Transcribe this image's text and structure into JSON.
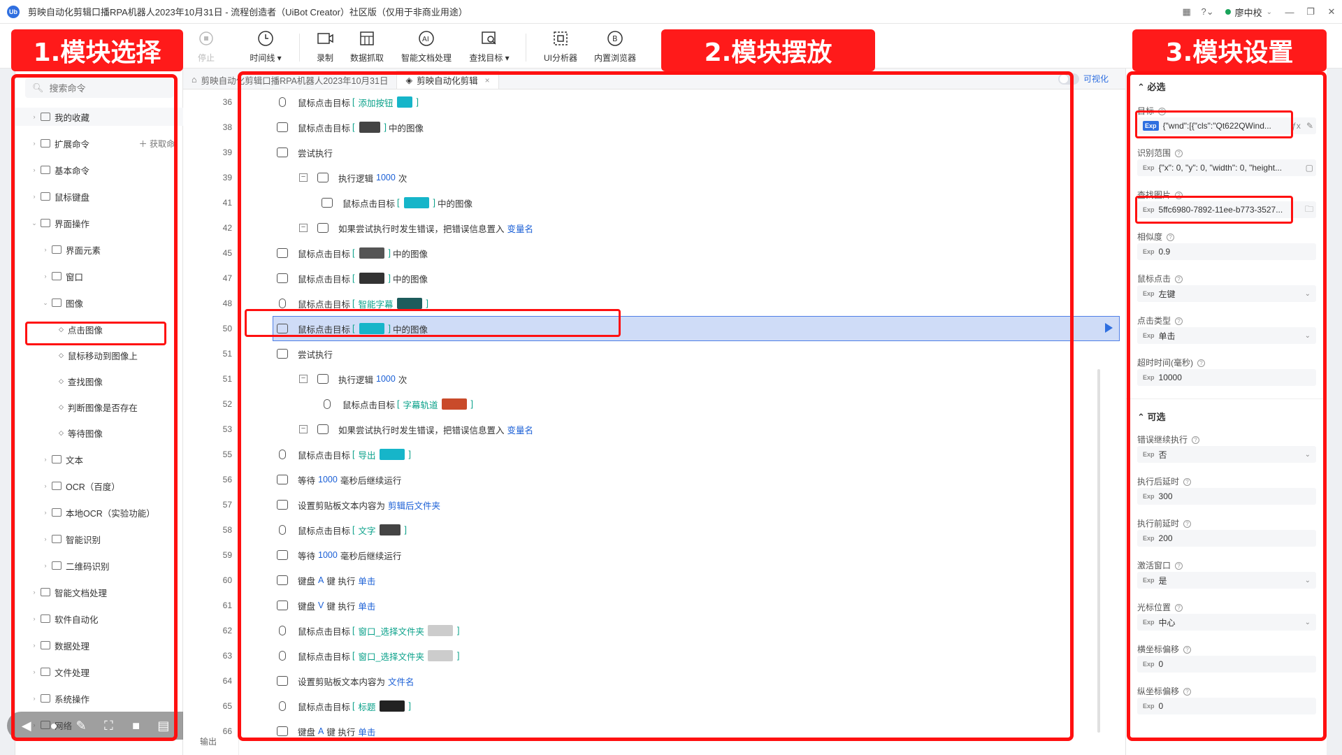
{
  "window": {
    "title": "剪映自动化剪辑口播RPA机器人2023年10月31日 - 流程创造者（UiBot Creator）社区版（仅用于非商业用途）",
    "logo": "Ub",
    "user": "廖中校"
  },
  "toolbar": {
    "stop": "停止",
    "timeline": "时间线",
    "record": "录制",
    "data_scrape": "数据抓取",
    "smart_doc": "智能文档处理",
    "find_target": "查找目标",
    "ui_analyzer": "UI分析器",
    "browser": "内置浏览器"
  },
  "sidebar": {
    "search_placeholder": "搜索命令",
    "get_cmd": "获取命",
    "items": [
      "我的收藏",
      "扩展命令",
      "基本命令",
      "鼠标键盘",
      "界面操作",
      "界面元素",
      "窗口",
      "图像",
      "点击图像",
      "鼠标移动到图像上",
      "查找图像",
      "判断图像是否存在",
      "等待图像",
      "文本",
      "OCR（百度）",
      "本地OCR（实验功能）",
      "智能识别",
      "二维码识别",
      "智能文档处理",
      "软件自动化",
      "数据处理",
      "文件处理",
      "系统操作",
      "网络"
    ]
  },
  "workspace": {
    "tab_path": "剪映自动化剪辑口播RPA机器人2023年10月31日",
    "tab_active": "剪映自动化剪辑",
    "visualize": "可视化",
    "output": "输出",
    "rows": [
      {
        "ln": "36",
        "pre": "鼠标点击目标",
        "g": "添加按钮",
        "post": ""
      },
      {
        "ln": "38",
        "pre": "鼠标点击目标",
        "g": "",
        "post": "中的图像"
      },
      {
        "ln": "39",
        "pre": "尝试执行",
        "g": "",
        "post": ""
      },
      {
        "ln": "39",
        "pre": "执行逻辑",
        "k": "1000",
        "post": "次"
      },
      {
        "ln": "41",
        "pre": "鼠标点击目标",
        "g": "",
        "post": "中的图像"
      },
      {
        "ln": "42",
        "pre": "如果尝试执行时发生错误，把错误信息置入",
        "k": "变量名",
        "post": ""
      },
      {
        "ln": "45",
        "pre": "鼠标点击目标",
        "g": "",
        "post": "中的图像"
      },
      {
        "ln": "47",
        "pre": "鼠标点击目标",
        "g": "",
        "post": "中的图像"
      },
      {
        "ln": "48",
        "pre": "鼠标点击目标",
        "g": "智能字幕",
        "post": ""
      },
      {
        "ln": "50",
        "pre": "鼠标点击目标",
        "g": "",
        "post": "中的图像"
      },
      {
        "ln": "51",
        "pre": "尝试执行",
        "g": "",
        "post": ""
      },
      {
        "ln": "51",
        "pre": "执行逻辑",
        "k": "1000",
        "post": "次"
      },
      {
        "ln": "52",
        "pre": "鼠标点击目标",
        "g": "字幕轨道",
        "post": ""
      },
      {
        "ln": "53",
        "pre": "如果尝试执行时发生错误，把错误信息置入",
        "k": "变量名",
        "post": ""
      },
      {
        "ln": "55",
        "pre": "鼠标点击目标",
        "g": "导出",
        "post": ""
      },
      {
        "ln": "56",
        "pre": "等待",
        "k": "1000",
        "post": "毫秒后继续运行"
      },
      {
        "ln": "57",
        "pre": "设置剪贴板文本内容为",
        "k": "剪辑后文件夹",
        "post": ""
      },
      {
        "ln": "58",
        "pre": "鼠标点击目标",
        "g": "文字",
        "post": ""
      },
      {
        "ln": "59",
        "pre": "等待",
        "k": "1000",
        "post": "毫秒后继续运行"
      },
      {
        "ln": "60",
        "pre": "键盘",
        "k": "A",
        "post": "键 执行",
        "k2": "单击"
      },
      {
        "ln": "61",
        "pre": "键盘",
        "k": "V",
        "post": "键 执行",
        "k2": "单击"
      },
      {
        "ln": "62",
        "pre": "鼠标点击目标",
        "g": "窗口_选择文件夹",
        "post": ""
      },
      {
        "ln": "63",
        "pre": "鼠标点击目标",
        "g": "窗口_选择文件夹",
        "post": ""
      },
      {
        "ln": "64",
        "pre": "设置剪贴板文本内容为",
        "k": "文件名",
        "post": ""
      },
      {
        "ln": "65",
        "pre": "鼠标点击目标",
        "g": "标题",
        "post": ""
      },
      {
        "ln": "66",
        "pre": "键盘",
        "k": "A",
        "post": "键 执行",
        "k2": "单击"
      }
    ]
  },
  "props": {
    "required": "必选",
    "optional": "可选",
    "target_label": "目标",
    "target_val": "{\"wnd\":[{\"cls\":\"Qt622QWind...",
    "range_label": "识别范围",
    "range_val": "{\"x\": 0, \"y\": 0, \"width\": 0, \"height...",
    "img_label": "查找图片",
    "img_val": "5ffc6980-7892-11ee-b773-3527...",
    "sim_label": "相似度",
    "sim_val": "0.9",
    "click_label": "鼠标点击",
    "click_val": "左键",
    "type_label": "点击类型",
    "type_val": "单击",
    "timeout_label": "超时时间(毫秒)",
    "timeout_val": "10000",
    "err_label": "错误继续执行",
    "err_val": "否",
    "after_label": "执行后延时",
    "after_val": "300",
    "before_label": "执行前延时",
    "before_val": "200",
    "activate_label": "激活窗口",
    "activate_val": "是",
    "cursor_label": "光标位置",
    "cursor_val": "中心",
    "xoff_label": "横坐标偏移",
    "xoff_val": "0",
    "yoff_label": "纵坐标偏移",
    "yoff_val": "0",
    "exp": "Exp"
  },
  "annotations": {
    "label1": "1.模块选择",
    "label2": "2.模块摆放",
    "label3": "3.模块设置",
    "color": "#ff1010"
  }
}
